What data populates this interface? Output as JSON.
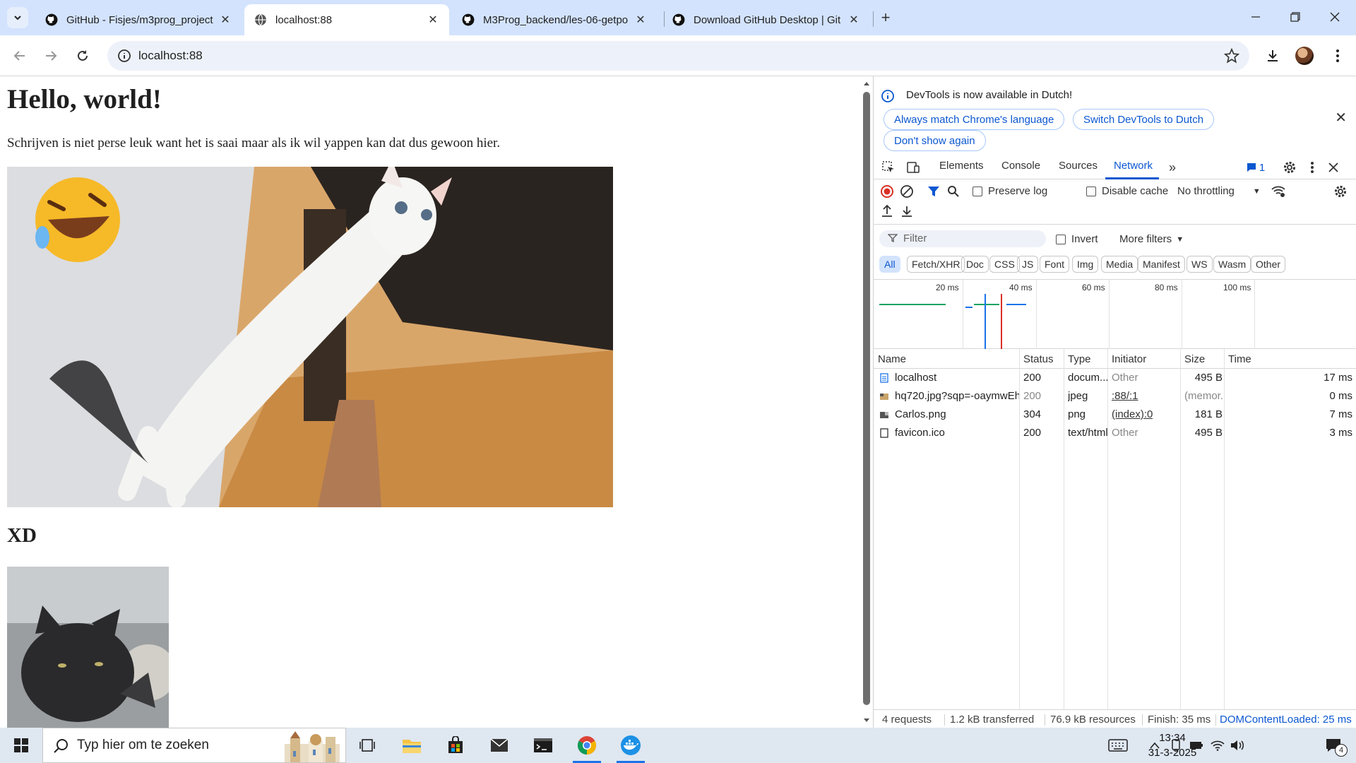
{
  "tabs": [
    {
      "title": "GitHub - Fisjes/m3prog_project",
      "icon": "github-icon"
    },
    {
      "title": "localhost:88",
      "icon": "globe-icon"
    },
    {
      "title": "M3Prog_backend/les-06-getpo",
      "icon": "github-icon"
    },
    {
      "title": "Download GitHub Desktop | Git",
      "icon": "github-icon"
    }
  ],
  "address": {
    "url": "localhost:88"
  },
  "page": {
    "heading": "Hello, world!",
    "paragraph": "Schrijven is niet perse leuk want het is saai maar als ik wil yappen kan dat dus gewoon hier.",
    "subheading": "XD"
  },
  "devtools": {
    "info_message": "DevTools is now available in Dutch!",
    "info_buttons": [
      "Always match Chrome's language",
      "Switch DevTools to Dutch",
      "Don't show again"
    ],
    "panel_tabs": [
      "Elements",
      "Console",
      "Sources",
      "Network"
    ],
    "issues_count": "1",
    "toolbar": {
      "preserve_log": "Preserve log",
      "disable_cache": "Disable cache",
      "throttling": "No throttling"
    },
    "filter": {
      "placeholder": "Filter",
      "invert": "Invert",
      "more_filters": "More filters"
    },
    "type_filters": [
      "All",
      "Fetch/XHR",
      "Doc",
      "CSS",
      "JS",
      "Font",
      "Img",
      "Media",
      "Manifest",
      "WS",
      "Wasm",
      "Other"
    ],
    "timeline_labels": [
      "20 ms",
      "40 ms",
      "60 ms",
      "80 ms",
      "100 ms"
    ],
    "columns": [
      "Name",
      "Status",
      "Type",
      "Initiator",
      "Size",
      "Time"
    ],
    "requests": [
      {
        "name": "localhost",
        "status": "200",
        "type": "docum...",
        "initiator": "Other",
        "size": "495 B",
        "time": "17 ms"
      },
      {
        "name": "hq720.jpg?sqp=-oaymwEhCK4...",
        "status": "200",
        "type": "jpeg",
        "initiator": ":88/:1",
        "size": "(memor...",
        "time": "0 ms"
      },
      {
        "name": "Carlos.png",
        "status": "304",
        "type": "png",
        "initiator": "(index):0",
        "size": "181 B",
        "time": "7 ms"
      },
      {
        "name": "favicon.ico",
        "status": "200",
        "type": "text/html",
        "initiator": "Other",
        "size": "495 B",
        "time": "3 ms"
      }
    ],
    "status_bar": {
      "requests": "4 requests",
      "transferred": "1.2 kB transferred",
      "resources": "76.9 kB resources",
      "finish": "Finish: 35 ms",
      "dom_loaded": "DOMContentLoaded: 25 ms"
    }
  },
  "taskbar": {
    "search_placeholder": "Typ hier om te zoeken",
    "time": "13:34",
    "date": "31-3-2025",
    "notifications": "4"
  },
  "colors": {
    "accent": "#0b57d0",
    "tab_strip": "#d3e3fd",
    "record_red": "#d93025"
  }
}
